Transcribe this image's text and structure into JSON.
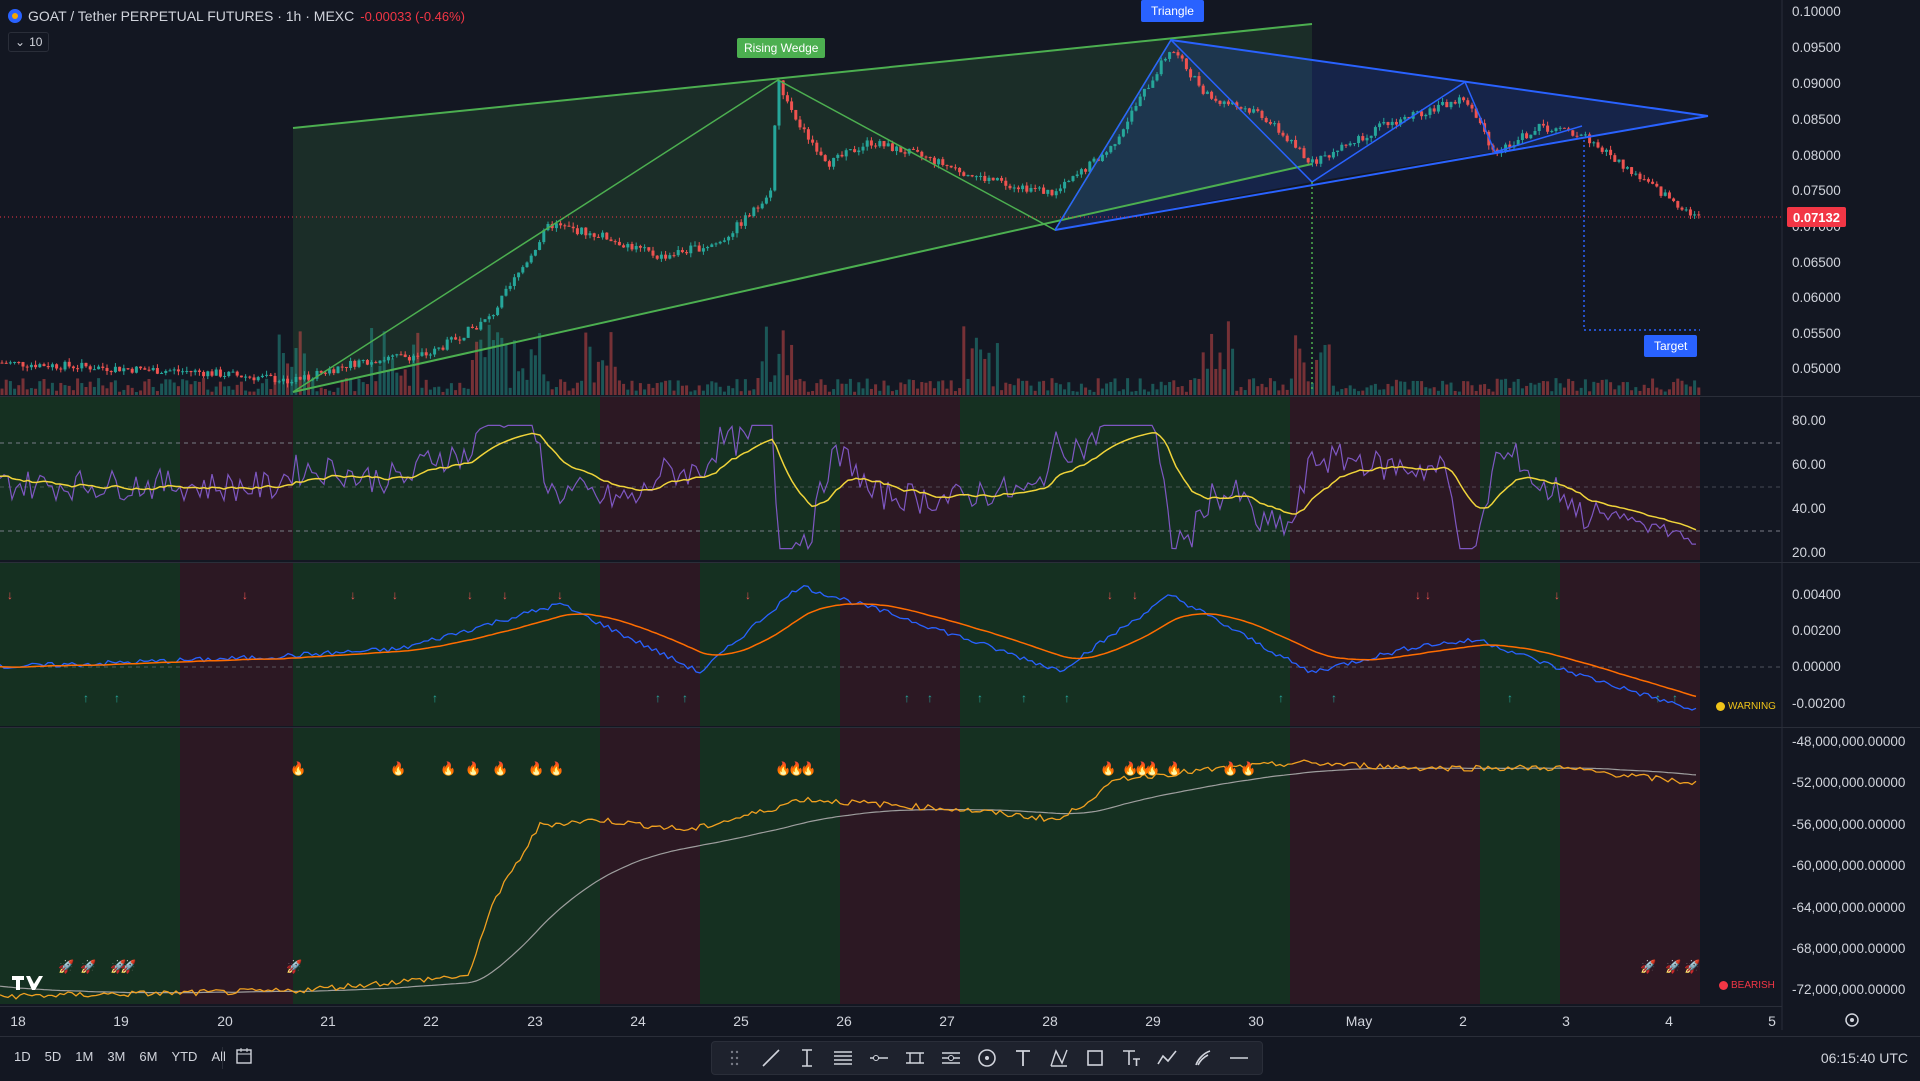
{
  "header": {
    "symbol": "GOAT / Tether PERPETUAL FUTURES · 1h · MEXC",
    "change": "-0.00033 (-0.46%)",
    "interval_badge": "10"
  },
  "patterns": {
    "rising_wedge": "Rising Wedge",
    "triangle": "Triangle",
    "target": "Target"
  },
  "price_axis": [
    "0.10000",
    "0.09500",
    "0.09000",
    "0.08500",
    "0.08000",
    "0.07500",
    "0.07000",
    "0.06500",
    "0.06000",
    "0.05500",
    "0.05000"
  ],
  "current_price": "0.07132",
  "rsi_axis": [
    "80.00",
    "60.00",
    "40.00",
    "20.00"
  ],
  "macd_axis": [
    "0.00400",
    "0.00200",
    "0.00000",
    "-0.00200"
  ],
  "macd_badge": "WARNING",
  "obv_axis": [
    "-48,000,000.00000",
    "-52,000,000.00000",
    "-56,000,000.00000",
    "-60,000,000.00000",
    "-64,000,000.00000",
    "-68,000,000.00000",
    "-72,000,000.00000"
  ],
  "obv_badge": "BEARISH",
  "time_axis": [
    "18",
    "19",
    "20",
    "21",
    "22",
    "23",
    "24",
    "25",
    "26",
    "27",
    "28",
    "29",
    "30",
    "May",
    "2",
    "3",
    "4",
    "5"
  ],
  "range_buttons": [
    "1D",
    "5D",
    "1M",
    "3M",
    "6M",
    "YTD",
    "All"
  ],
  "clock": "06:15:40 UTC",
  "icons": {
    "calendar": "calendar-icon",
    "settings": "settings-icon",
    "tools": [
      "drag-handle-icon",
      "trend-line-icon",
      "cursor-text-icon",
      "horizontal-lines-icon",
      "horizontal-ray-icon",
      "parallel-channel-icon",
      "regression-icon",
      "circle-icon",
      "text-icon",
      "pattern-icon",
      "rectangle-icon",
      "text-note-icon",
      "path-icon",
      "brush-icon",
      "horizontal-line-icon"
    ]
  },
  "colors": {
    "background": "#131722",
    "up": "#26a69a",
    "down": "#ef5350",
    "wedge": "#4caf50",
    "triangle": "#2962ff",
    "current_price": "#f23645",
    "warning": "#f0c419"
  }
}
